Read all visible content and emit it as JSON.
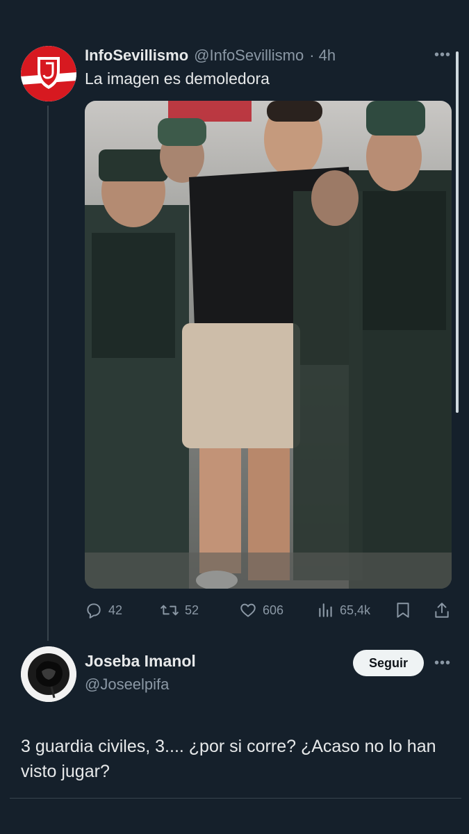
{
  "tweet": {
    "author_name": "InfoSevillismo",
    "author_handle": "@InfoSevillismo",
    "time": "· 4h",
    "text": "La imagen es demoledora",
    "more_label": "•••",
    "avatar_icon": "sevilla-crest-icon",
    "image_description": "Photo attachment",
    "stats": {
      "replies": "42",
      "retweets": "52",
      "likes": "606",
      "views": "65,4k"
    }
  },
  "reply": {
    "author_name": "Joseba Imanol",
    "author_handle": "@Joseelpifa",
    "follow_label": "Seguir",
    "more_label": "•••",
    "text": "3 guardia civiles, 3.... ¿por si corre? ¿Acaso no lo han visto jugar?"
  },
  "colors": {
    "background": "#15202b",
    "text": "#e7e9ea",
    "secondary": "#8b98a5",
    "border": "#38444d",
    "brand_red": "#d71920"
  }
}
